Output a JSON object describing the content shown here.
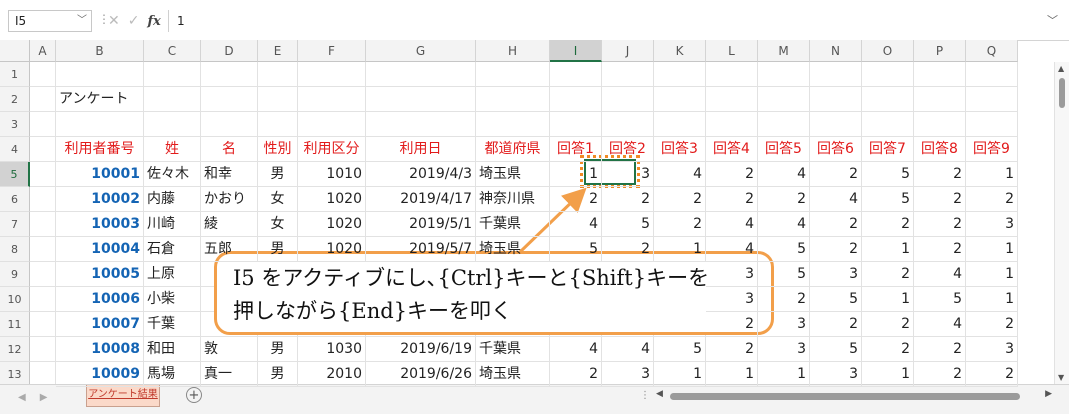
{
  "formula_bar": {
    "name_box": "I5",
    "sep": "⋮",
    "formula": "1"
  },
  "columns": [
    "A",
    "B",
    "C",
    "D",
    "E",
    "F",
    "G",
    "H",
    "I",
    "J",
    "K",
    "L",
    "M",
    "N",
    "O",
    "P",
    "Q"
  ],
  "rows": [
    "1",
    "2",
    "3",
    "4",
    "5",
    "6",
    "7",
    "8",
    "9",
    "10",
    "11",
    "12",
    "13"
  ],
  "sheet": {
    "title": "アンケート",
    "headers": [
      "利用者番号",
      "姓",
      "名",
      "性別",
      "利用区分",
      "利用日",
      "都道府県",
      "回答1",
      "回答2",
      "回答3",
      "回答4",
      "回答5",
      "回答6",
      "回答7",
      "回答8",
      "回答9"
    ],
    "data": [
      [
        "10001",
        "佐々木",
        "和幸",
        "男",
        "1010",
        "2019/4/3",
        "埼玉県",
        "1",
        "3",
        "4",
        "2",
        "4",
        "2",
        "5",
        "2",
        "1"
      ],
      [
        "10002",
        "内藤",
        "かおり",
        "女",
        "1020",
        "2019/4/17",
        "神奈川県",
        "2",
        "2",
        "2",
        "2",
        "2",
        "4",
        "5",
        "2",
        "2"
      ],
      [
        "10003",
        "川崎",
        "綾",
        "女",
        "1020",
        "2019/5/1",
        "千葉県",
        "4",
        "5",
        "2",
        "4",
        "4",
        "2",
        "2",
        "2",
        "3"
      ],
      [
        "10004",
        "石倉",
        "五郎",
        "男",
        "1020",
        "2019/5/7",
        "埼玉県",
        "5",
        "2",
        "1",
        "4",
        "5",
        "2",
        "1",
        "2",
        "1"
      ],
      [
        "10005",
        "上原",
        "",
        "",
        "",
        "",
        "",
        "",
        "",
        "",
        "3",
        "5",
        "3",
        "2",
        "4",
        "1"
      ],
      [
        "10006",
        "小柴",
        "",
        "",
        "",
        "",
        "",
        "",
        "",
        "",
        "3",
        "2",
        "5",
        "1",
        "5",
        "1"
      ],
      [
        "10007",
        "千葉",
        "",
        "",
        "",
        "",
        "",
        "",
        "",
        "",
        "2",
        "3",
        "2",
        "2",
        "4",
        "2"
      ],
      [
        "10008",
        "和田",
        "敦",
        "男",
        "1030",
        "2019/6/19",
        "千葉県",
        "4",
        "4",
        "5",
        "2",
        "3",
        "5",
        "2",
        "2",
        "3"
      ],
      [
        "10009",
        "馬場",
        "真一",
        "男",
        "2010",
        "2019/6/26",
        "埼玉県",
        "2",
        "3",
        "1",
        "1",
        "1",
        "3",
        "1",
        "2",
        "2"
      ]
    ]
  },
  "callout": {
    "line1": "I5 をアクティブにし､{Ctrl}キーと{Shift}キーを",
    "line2": "押しながら{End}キーを叩く"
  },
  "sheet_tabs": {
    "active": "アンケート結果",
    "add": "+"
  },
  "colors": {
    "header_red": "#e21b1b",
    "id_blue": "#1464b4",
    "excel_green": "#217346",
    "callout_orange": "#f29f4a"
  }
}
